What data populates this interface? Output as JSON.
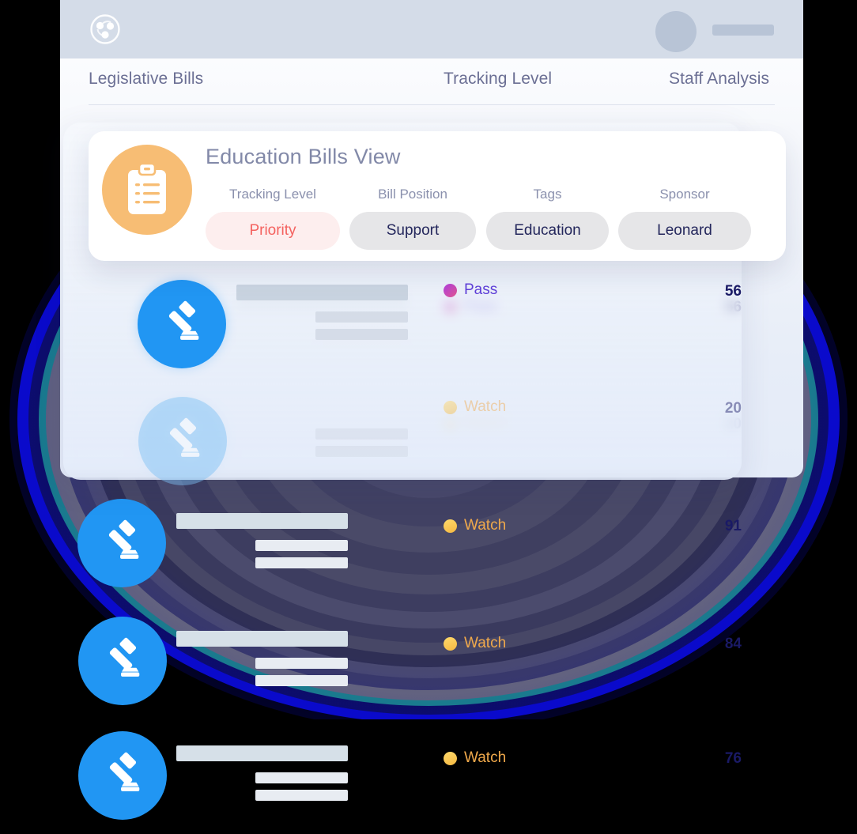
{
  "app": {
    "logo_icon": "collaboration-circle-logo",
    "avatar_icon": "user-avatar-placeholder",
    "username_placeholder": ""
  },
  "table": {
    "columns": [
      {
        "key": "bills",
        "label": "Legislative Bills"
      },
      {
        "key": "tracking",
        "label": "Tracking Level"
      },
      {
        "key": "staff",
        "label": "Staff Analysis"
      }
    ],
    "rows": [
      {
        "icon": "gavel-icon",
        "status_label": "Pass",
        "status_color": "#5f3fd9",
        "dot": "pass",
        "score": "56",
        "faded": false
      },
      {
        "icon": "gavel-icon",
        "status_label": "Watch",
        "status_color": "#f0a94b",
        "dot": "watch",
        "score": "20",
        "faded": true
      },
      {
        "icon": "gavel-icon",
        "status_label": "Watch",
        "status_color": "#f0a94b",
        "dot": "watch",
        "score": "91",
        "faded": false
      },
      {
        "icon": "gavel-icon",
        "status_label": "Watch",
        "status_color": "#f0a94b",
        "dot": "watch",
        "score": "84",
        "faded": false
      },
      {
        "icon": "gavel-icon",
        "status_label": "Watch",
        "status_color": "#f0a94b",
        "dot": "watch",
        "score": "76",
        "faded": false
      }
    ]
  },
  "highlight_card": {
    "title": "Education Bills View",
    "icon": "clipboard-list-icon",
    "icon_bg": "#f7bd74",
    "filters": [
      {
        "label": "Tracking Level",
        "value": "Priority",
        "style": "priority"
      },
      {
        "label": "Bill Position",
        "value": "Support",
        "style": "plain"
      },
      {
        "label": "Tags",
        "value": "Education",
        "style": "plain"
      },
      {
        "label": "Sponsor",
        "value": "Leonard",
        "style": "plain"
      }
    ]
  },
  "colors": {
    "accent_blue": "#2196f3",
    "accent_blue_light": "#7dc0f5",
    "topbar": "#d4dce8",
    "header_text": "#6b6f94",
    "priority_text": "#f4625f",
    "priority_bg": "#fdeeee",
    "chip_bg": "#e6e6e8",
    "chip_text": "#24275c",
    "score_text": "#1a1a66",
    "pass_dot": "#b13fe0",
    "watch_dot": "#f5b942"
  }
}
